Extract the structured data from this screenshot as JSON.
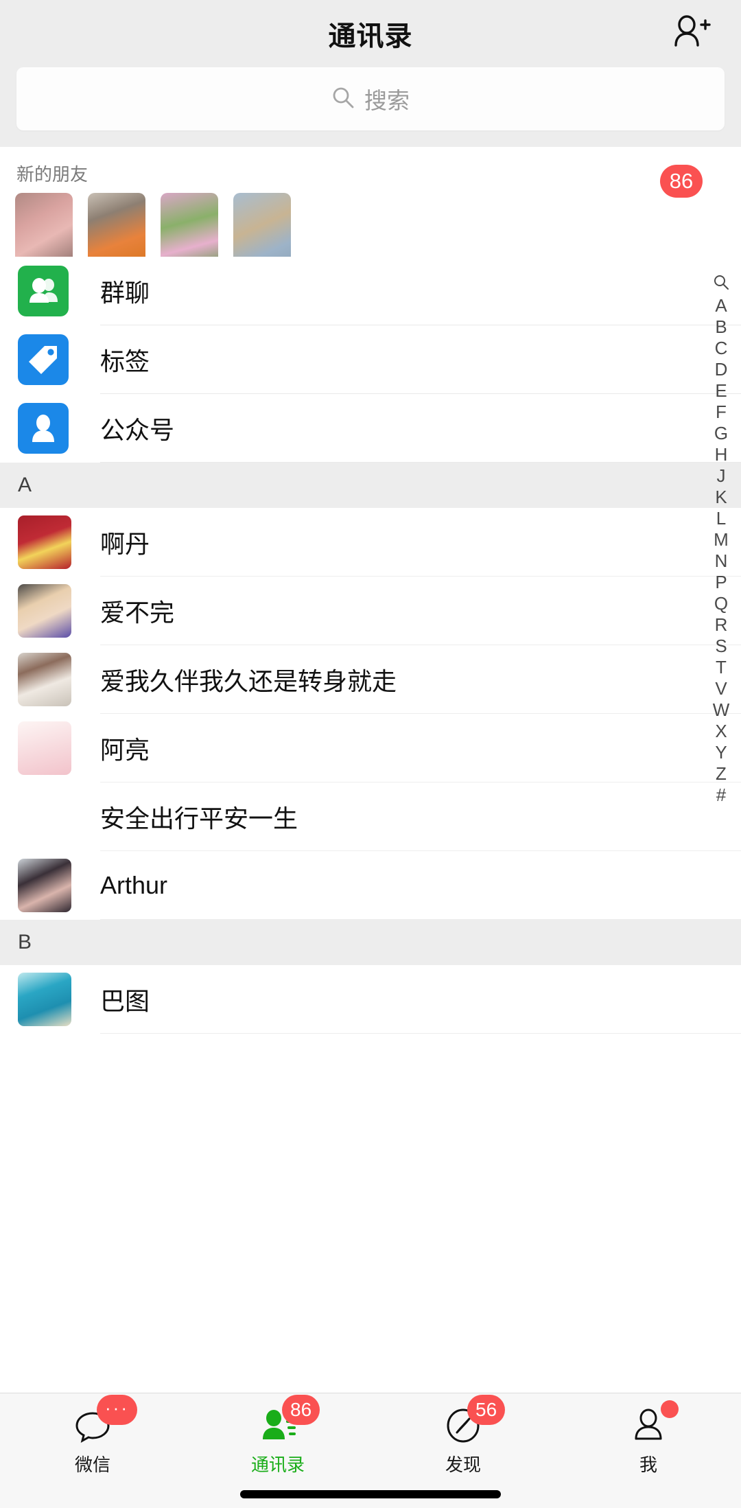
{
  "header": {
    "title": "通讯录",
    "add_contact_icon": "add-person-icon"
  },
  "search": {
    "placeholder": "搜索",
    "icon": "search-icon"
  },
  "new_friends": {
    "label": "新的朋友",
    "badge": "86",
    "avatar_count": 4
  },
  "entries": [
    {
      "label": "群聊",
      "icon": "group-chat-icon",
      "color": "#22b14c"
    },
    {
      "label": "标签",
      "icon": "tag-icon",
      "color": "#1b88e8"
    },
    {
      "label": "公众号",
      "icon": "official-account-icon",
      "color": "#1b88e8"
    }
  ],
  "sections": [
    {
      "letter": "A",
      "contacts": [
        {
          "name": "啊丹"
        },
        {
          "name": "爱不完"
        },
        {
          "name": "爱我久伴我久还是转身就走"
        },
        {
          "name": "阿亮"
        },
        {
          "name": "安全出行平安一生"
        },
        {
          "name": "Arthur"
        }
      ]
    },
    {
      "letter": "B",
      "contacts": [
        {
          "name": "巴图"
        }
      ]
    }
  ],
  "index_rail": {
    "search_icon": "search-icon",
    "letters": [
      "A",
      "B",
      "C",
      "D",
      "E",
      "F",
      "G",
      "H",
      "J",
      "K",
      "L",
      "M",
      "N",
      "P",
      "Q",
      "R",
      "S",
      "T",
      "V",
      "W",
      "X",
      "Y",
      "Z",
      "#"
    ]
  },
  "tabbar": {
    "items": [
      {
        "label": "微信",
        "icon": "chat-bubble-icon",
        "badge": "···",
        "badge_type": "dots",
        "active": false
      },
      {
        "label": "通讯录",
        "icon": "contacts-icon",
        "badge": "86",
        "badge_type": "count",
        "active": true
      },
      {
        "label": "发现",
        "icon": "compass-icon",
        "badge": "56",
        "badge_type": "count",
        "active": false
      },
      {
        "label": "我",
        "icon": "person-icon",
        "badge": "",
        "badge_type": "dot",
        "active": false
      }
    ]
  },
  "colors": {
    "accent_green": "#1aad19",
    "badge_red": "#fa5151",
    "header_bg": "#ededed"
  }
}
